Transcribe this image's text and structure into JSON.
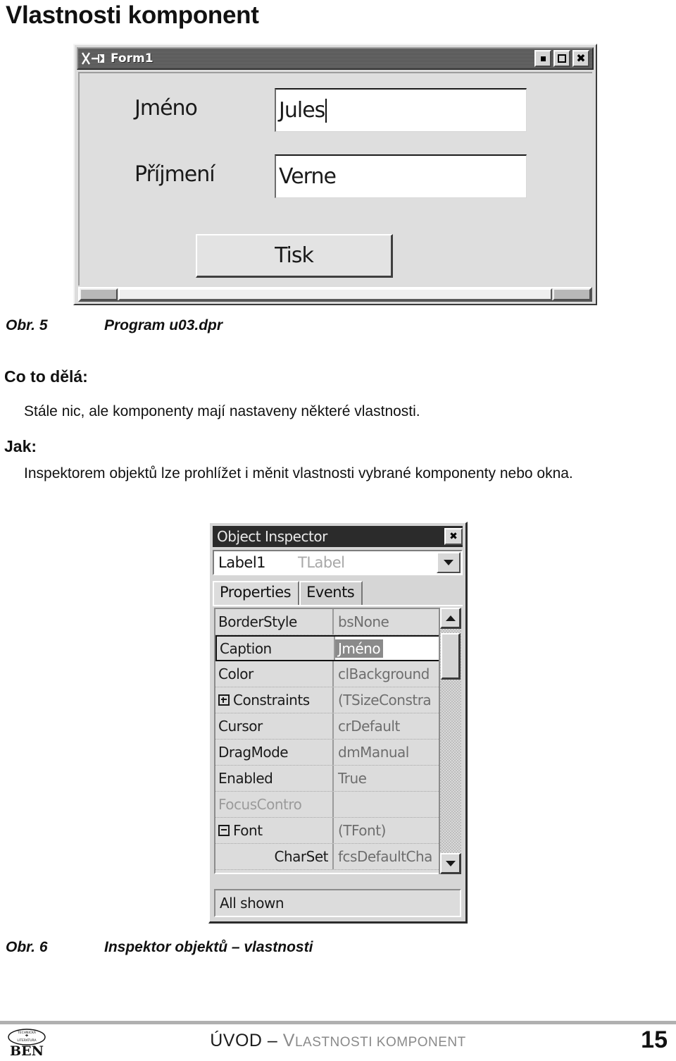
{
  "page": {
    "title": "Vlastnosti komponent",
    "number": "15"
  },
  "form_window": {
    "title": "Form1",
    "sysicon": "x-window-icon",
    "buttons": {
      "minimize": "minimize-icon",
      "maximize": "maximize-icon",
      "close": "close-icon"
    },
    "fields": [
      {
        "label": "Jméno",
        "value": "Jules"
      },
      {
        "label": "Příjmení",
        "value": "Verne"
      }
    ],
    "print_button": "Tisk"
  },
  "figure5": {
    "number": "Obr. 5",
    "caption": "Program u03.dpr"
  },
  "what_it_does": {
    "heading": "Co to dělá:",
    "text": "Stále nic, ale komponenty mají nastaveny některé vlastnosti."
  },
  "how": {
    "heading": "Jak:",
    "text": "Inspektorem objektů lze prohlížet i měnit vlastnosti vybrané komponenty nebo okna."
  },
  "object_inspector": {
    "title": "Object Inspector",
    "close_label": "✖",
    "component": {
      "name": "Label1",
      "type": "TLabel"
    },
    "tabs": [
      {
        "label": "Properties",
        "active": true
      },
      {
        "label": "Events",
        "active": false
      }
    ],
    "rows": [
      {
        "name": "BorderStyle",
        "value": "bsNone",
        "expander": "",
        "greyed": false,
        "indent": false,
        "selected": false
      },
      {
        "name": "Caption",
        "value": "Jméno",
        "expander": "",
        "greyed": false,
        "indent": false,
        "selected": true
      },
      {
        "name": "Color",
        "value": "clBackground",
        "expander": "",
        "greyed": false,
        "indent": false,
        "selected": false
      },
      {
        "name": "Constraints",
        "value": "(TSizeConstra",
        "expander": "plus",
        "greyed": false,
        "indent": false,
        "selected": false
      },
      {
        "name": "Cursor",
        "value": "crDefault",
        "expander": "",
        "greyed": false,
        "indent": false,
        "selected": false
      },
      {
        "name": "DragMode",
        "value": "dmManual",
        "expander": "",
        "greyed": false,
        "indent": false,
        "selected": false
      },
      {
        "name": "Enabled",
        "value": "True",
        "expander": "",
        "greyed": false,
        "indent": false,
        "selected": false
      },
      {
        "name": "FocusContro",
        "value": "",
        "expander": "",
        "greyed": true,
        "indent": false,
        "selected": false
      },
      {
        "name": "Font",
        "value": "(TFont)",
        "expander": "minus",
        "greyed": false,
        "indent": false,
        "selected": false
      },
      {
        "name": "CharSet",
        "value": "fcsDefaultCha",
        "expander": "",
        "greyed": false,
        "indent": true,
        "selected": false
      }
    ],
    "status": "All shown",
    "scrollbar": {
      "up": "scroll-up-icon",
      "down": "scroll-down-icon"
    }
  },
  "figure6": {
    "number": "Obr. 6",
    "caption": "Inspektor objektů – vlastnosti"
  },
  "footer": {
    "logo_text": "BEN",
    "logo_motto_top": "TECHNICKÁ",
    "logo_motto_bottom": "LITERATURA",
    "section_main": "ÚVOD – ",
    "section_sub_cap": "V",
    "section_sub_rest": "LASTNOSTI KOMPONENT"
  }
}
